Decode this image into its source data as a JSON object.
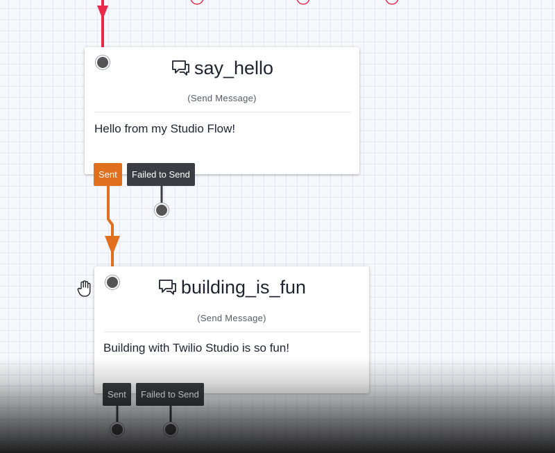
{
  "widgets": [
    {
      "name": "say_hello",
      "type": "(Send Message)",
      "body": "Hello from my Studio Flow!",
      "transitions": [
        "Sent",
        "Failed to Send"
      ]
    },
    {
      "name": "building_is_fun",
      "type": "(Send Message)",
      "body": "Building with Twilio Studio is so fun!",
      "transitions": [
        "Sent",
        "Failed to Send"
      ]
    }
  ],
  "icons": {
    "widget": "message-bubble-icon",
    "cursor": "grab-hand-icon"
  },
  "colors": {
    "incoming_wire": "#e8294a",
    "sent_wire": "#e06f1e",
    "failed_transition": "#3b3d42"
  }
}
